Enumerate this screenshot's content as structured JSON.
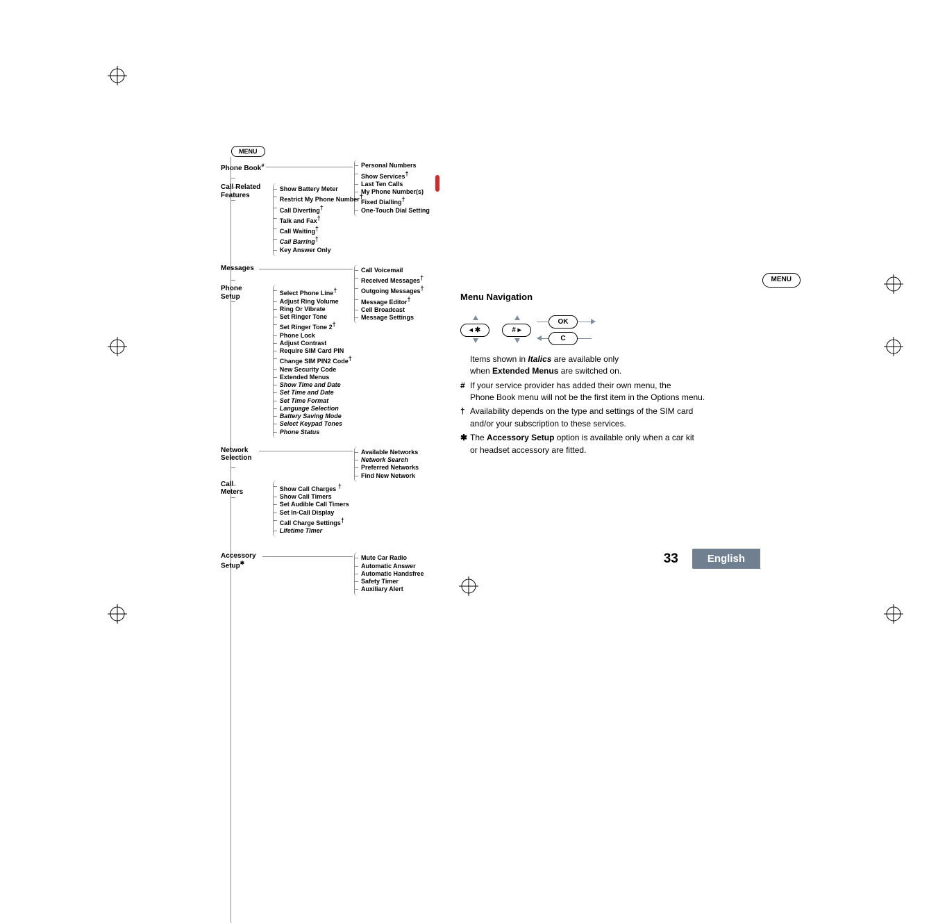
{
  "page_number": "33",
  "language": "English",
  "menu_button_label": "MENU",
  "right_menu_button_label": "MENU",
  "ok_label": "OK",
  "c_label": "C",
  "star_key": "✱",
  "hash_key": "#",
  "nav_title": "Menu Navigation",
  "tree": {
    "top": "MENU",
    "phone_book": {
      "label": "Phone Book",
      "hash": "#",
      "items": [
        {
          "t": "Personal Numbers"
        },
        {
          "t": "Show Services",
          "dag": true
        },
        {
          "t": "Last Ten Calls"
        },
        {
          "t": "My Phone Number(s)"
        },
        {
          "t": "Fixed Dialling",
          "dag": true
        },
        {
          "t": "One-Touch Dial Setting"
        }
      ]
    },
    "call_related": {
      "label_l1": "Call Related",
      "label_l2": "Features",
      "items": [
        {
          "t": "Show Battery Meter"
        },
        {
          "t": "Restrict My Phone Number",
          "dag": true
        },
        {
          "t": "Call Diverting",
          "dag": true
        },
        {
          "t": "Talk and Fax",
          "dag": true
        },
        {
          "t": "Call Waiting",
          "dag": true
        },
        {
          "t": "Call Barring",
          "italic": true,
          "dag": true
        },
        {
          "t": "Key Answer Only"
        }
      ]
    },
    "messages": {
      "label": "Messages",
      "items": [
        {
          "t": "Call Voicemail"
        },
        {
          "t": "Received Messages",
          "dag": true
        },
        {
          "t": "Outgoing Messages",
          "dag": true
        },
        {
          "t": "Message Editor",
          "dag": true
        },
        {
          "t": "Cell Broadcast"
        },
        {
          "t": "Message Settings"
        }
      ]
    },
    "phone_setup": {
      "label_l1": "Phone",
      "label_l2": "Setup",
      "items": [
        {
          "t": "Select Phone Line",
          "dag": true
        },
        {
          "t": "Adjust Ring Volume"
        },
        {
          "t": "Ring Or Vibrate"
        },
        {
          "t": "Set Ringer Tone"
        },
        {
          "t": "Set Ringer Tone 2",
          "dag": true
        },
        {
          "t": "Phone Lock"
        },
        {
          "t": "Adjust Contrast"
        },
        {
          "t": "Require SIM Card PIN"
        },
        {
          "t": "Change SIM PIN2 Code",
          "dag": true
        },
        {
          "t": "New Security Code"
        },
        {
          "t": "Extended Menus"
        },
        {
          "t": "Show Time and Date",
          "italic": true
        },
        {
          "t": "Set Time and Date",
          "italic": true
        },
        {
          "t": "Set Time Format",
          "italic": true
        },
        {
          "t": "Language Selection",
          "italic": true
        },
        {
          "t": "Battery Saving Mode",
          "italic": true
        },
        {
          "t": "Select Keypad Tones",
          "italic": true
        },
        {
          "t": "Phone Status",
          "italic": true
        }
      ]
    },
    "network": {
      "label_l1": "Network",
      "label_l2": "Selection",
      "items": [
        {
          "t": "Available Networks"
        },
        {
          "t": "Network Search",
          "italic": true
        },
        {
          "t": "Preferred Networks"
        },
        {
          "t": "Find New Network"
        }
      ]
    },
    "call_meters": {
      "label_l1": "Call",
      "label_l2": "Meters",
      "items": [
        {
          "t": "Show Call Charges",
          "dag": true
        },
        {
          "t": "Show Call Timers"
        },
        {
          "t": "Set Audible Call Timers"
        },
        {
          "t": "Set In-Call Display"
        },
        {
          "t": "Call Charge Settings",
          "dag": true
        },
        {
          "t": "Lifetime Timer",
          "italic": true
        }
      ]
    },
    "accessory": {
      "label_l1": "Accessory",
      "label_l2": "Setup",
      "star": "✱",
      "items": [
        {
          "t": "Mute Car Radio"
        },
        {
          "t": "Automatic Answer"
        },
        {
          "t": "Automatic Handsfree"
        },
        {
          "t": "Safety Timer"
        },
        {
          "t": "Auxiliary Alert"
        }
      ]
    }
  },
  "notes": {
    "italics_line_1": "Items shown in",
    "italics_word": "Italics",
    "italics_line_2": "are available only",
    "italics_line_3": "when",
    "extended_menus": "Extended Menus",
    "italics_line_4": "are switched on.",
    "hash_note_1": "If your service provider has added their own menu, the",
    "hash_note_2": "Phone Book menu will not be the first item in the Options menu.",
    "dag_note_1": "Availability depends on the type and settings of the SIM card",
    "dag_note_2": "and/or your subscription to these services.",
    "star_note_1a": "The",
    "star_note_1b": "Accessory Setup",
    "star_note_1c": "option is available only when a car kit",
    "star_note_2": "or headset accessory are fitted."
  }
}
